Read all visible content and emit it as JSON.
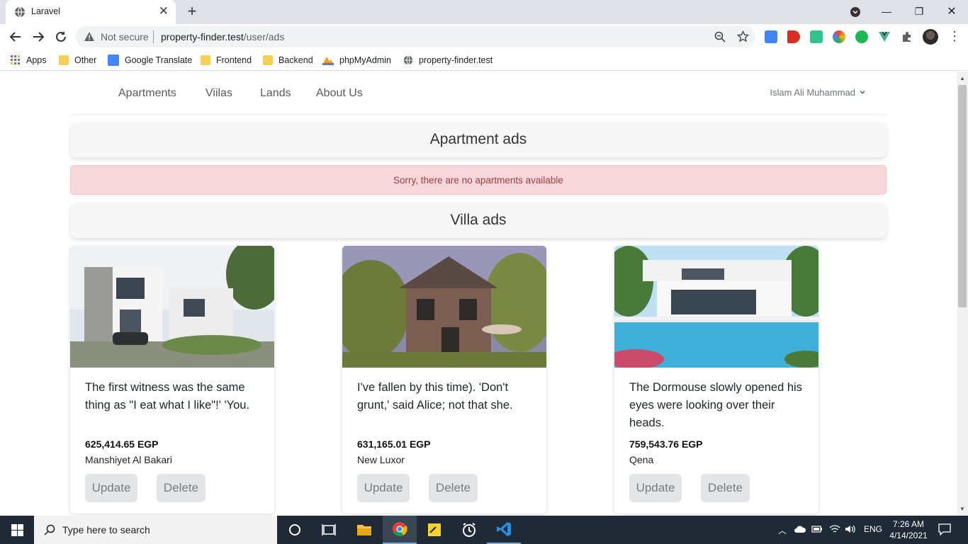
{
  "browser": {
    "tab_title": "Laravel",
    "not_secure": "Not secure",
    "url_host": "property-finder.test",
    "url_path": "/user/ads",
    "bookmarks": [
      "Apps",
      "Other",
      "Google Translate",
      "Frontend",
      "Backend",
      "phpMyAdmin",
      "property-finder.test"
    ]
  },
  "nav": {
    "links": [
      "Apartments",
      "Viilas",
      "Lands",
      "About Us"
    ],
    "user": "Islam Ali Muhammad"
  },
  "apartments": {
    "heading": "Apartment ads",
    "empty_message": "Sorry, there are no apartments available"
  },
  "villas": {
    "heading": "Villa ads",
    "cards": [
      {
        "description": "The first witness was the same thing as \"I eat what I like\"!' 'You.",
        "price": "625,414.65 EGP",
        "location": "Manshiyet Al Bakari",
        "update_label": "Update",
        "delete_label": "Delete"
      },
      {
        "description": "I've fallen by this time). 'Don't grunt,' said Alice; not that she.",
        "price": "631,165.01 EGP",
        "location": "New Luxor",
        "update_label": "Update",
        "delete_label": "Delete"
      },
      {
        "description": "The Dormouse slowly opened his eyes were looking over their heads.",
        "price": "759,543.76 EGP",
        "location": "Qena",
        "update_label": "Update",
        "delete_label": "Delete"
      }
    ]
  },
  "taskbar": {
    "search_placeholder": "Type here to search",
    "language": "ENG",
    "time": "7:26 AM",
    "date": "4/14/2021"
  },
  "colors": {
    "alert_bg": "#f8d7da",
    "alert_text": "#9b3e42",
    "taskbar": "#1f2a36"
  }
}
